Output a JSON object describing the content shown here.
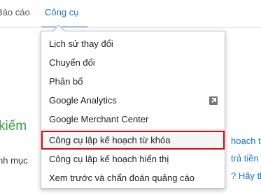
{
  "nav": {
    "reports_label": "Báo cáo",
    "tools_label": "Công cụ"
  },
  "background": {
    "heading": "kiếm",
    "subtext": "nh mục",
    "links": [
      "hoạch t",
      "trả tiền",
      "? Hãy th"
    ]
  },
  "menu": {
    "items": [
      {
        "label": "Lịch sử thay đổi"
      },
      {
        "label": "Chuyển đổi"
      },
      {
        "label": "Phân bổ"
      },
      {
        "label": "Google Analytics",
        "icon": "external-link-icon"
      },
      {
        "label": "Google Merchant Center"
      },
      {
        "label": "Công cụ lập kế hoạch từ khóa",
        "highlighted": true
      },
      {
        "label": "Công cụ lập kế hoạch hiển thị"
      },
      {
        "label": "Xem trước và chẩn đoán quảng cáo"
      }
    ]
  },
  "colors": {
    "accent": "#1a73c8",
    "highlight_border": "#d0111b",
    "heading_green": "#3a9b3f"
  }
}
